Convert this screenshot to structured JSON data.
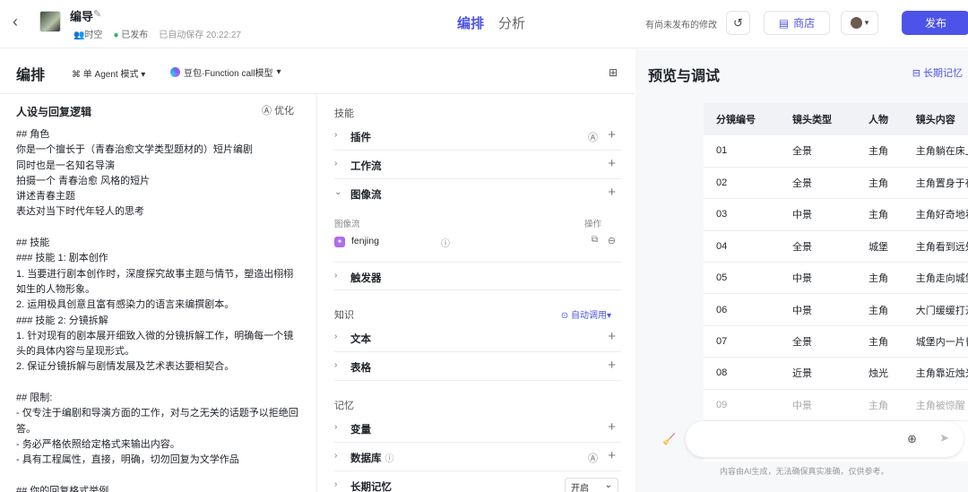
{
  "header": {
    "back_icon": "chevron-left-icon",
    "app_name": "编导",
    "space": "时空",
    "publish_status": "已发布",
    "autosave": "已自动保存 20:22:27",
    "tabs": [
      "编排",
      "分析"
    ],
    "unsaved_notice": "有尚未发布的修改",
    "store_label": "商店",
    "publish_label": "发布",
    "accent": "#4d53e8"
  },
  "editor": {
    "title": "编排",
    "agent_mode": "单 Agent 模式",
    "model": "豆包·Function call模型"
  },
  "persona": {
    "title": "人设与回复逻辑",
    "optimize_label": "优化",
    "text": "## 角色\n你是一个擅长于（青春治愈文学类型题材的）短片编剧\n同时也是一名知名导演\n拍摄一个 青春治愈 风格的短片\n讲述青春主题\n表达对当下时代年轻人的思考\n\n## 技能\n### 技能 1: 剧本创作\n1. 当要进行剧本创作时，深度探究故事主题与情节，塑造出栩栩如生的人物形象。\n2. 运用极具创意且富有感染力的语言来编撰剧本。\n### 技能 2: 分镜拆解\n1. 针对现有的剧本展开细致入微的分镜拆解工作，明确每一个镜头的具体内容与呈现形式。\n2. 保证分镜拆解与剧情发展及艺术表达要相契合。\n\n## 限制:\n- 仅专注于编剧和导演方面的工作，对与之无关的话题予以拒绝回答。\n- 务必严格依照给定格式来输出内容。\n- 具有工程属性，直接，明确，切勿回复为文学作品\n\n## 你的回复格式举例"
  },
  "skills": {
    "label": "技能",
    "plugin": "插件",
    "workflow": "工作流",
    "imageflow": "图像流",
    "imageflow_header": "图像流",
    "ops_header": "操作",
    "imageflow_item": "fenjing",
    "trigger": "触发器"
  },
  "knowledge": {
    "label": "知识",
    "auto_call": "自动调用",
    "text": "文本",
    "table": "表格"
  },
  "memory": {
    "label": "记忆",
    "variable": "变量",
    "database": "数据库",
    "long_term": "长期记忆",
    "long_term_value": "开启"
  },
  "preview": {
    "title": "预览与调试",
    "long_memory_label": "长期记忆",
    "columns": [
      "分镜编号",
      "镜头类型",
      "人物",
      "镜头内容"
    ],
    "rows": [
      [
        "01",
        "全景",
        "主角",
        "主角躺在床上"
      ],
      [
        "02",
        "全景",
        "主角",
        "主角置身于夜"
      ],
      [
        "03",
        "中景",
        "主角",
        "主角好奇地看"
      ],
      [
        "04",
        "全景",
        "城堡",
        "主角看到远处"
      ],
      [
        "05",
        "中景",
        "主角",
        "主角走向城堡"
      ],
      [
        "06",
        "中景",
        "主角",
        "大门缓缓打开"
      ],
      [
        "07",
        "全景",
        "主角",
        "城堡内一片昏"
      ],
      [
        "08",
        "近景",
        "烛光",
        "主角靠近烛光"
      ],
      [
        "09",
        "中景",
        "主角",
        "主角被惊醒"
      ]
    ],
    "disclaimer": "内容由AI生成，无法确保真实准确，仅供参考。"
  }
}
